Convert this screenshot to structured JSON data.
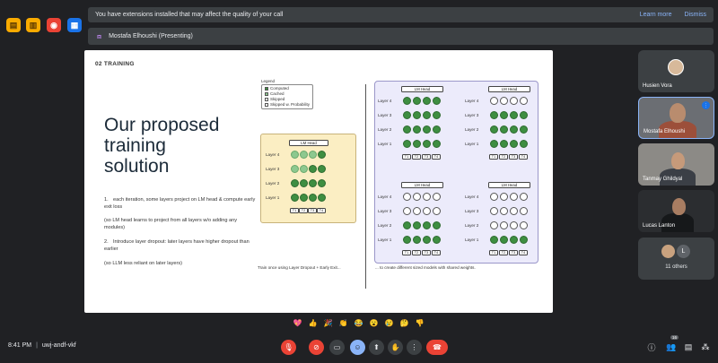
{
  "banner": {
    "warning_text": "You have extensions installed that may affect the quality of your call",
    "learn_more": "Learn more",
    "dismiss": "Dismiss",
    "presenter_text": "Mostafa Elhoushi (Presenting)"
  },
  "slide": {
    "section": "02  TRAINING",
    "title": "Our proposed\ntraining\nsolution",
    "bullet1_num": "1.",
    "bullet1": "each iteration, some layers project on LM head & compute early exit loss",
    "bullet1_note": "(so LM head learns to project from all layers w/o adding any modules)",
    "bullet2_num": "2.",
    "bullet2": "Introduce layer dropout: later layers have higher dropout than earlier",
    "bullet2_note": "(so LLM less reliant on later layers)",
    "legend_title": "Legend",
    "legend": [
      "Computed",
      "Cached",
      "Skipped",
      "Skipped w. Probability"
    ],
    "lm_head": "LM Head",
    "layers": [
      "Layer 4",
      "Layer 3",
      "Layer 2",
      "Layer 1"
    ],
    "tokens": [
      "T1",
      "T2",
      "T3",
      "T4"
    ],
    "caption_left": "Train once using Layer Dropout + Early Exit...",
    "caption_right": "... to create different sized models with shared weights."
  },
  "participants": [
    {
      "name": "Husien Vora"
    },
    {
      "name": "Mostafa Elhoushi"
    },
    {
      "name": "Tanmay Ghildyal"
    },
    {
      "name": "Lucas Lanton"
    }
  ],
  "others": {
    "label": "11 others",
    "initial": "L"
  },
  "reactions": [
    "💖",
    "👍",
    "🎉",
    "👏",
    "😂",
    "😮",
    "😢",
    "🤔",
    "👎"
  ],
  "meeting": {
    "time": "8:41 PM",
    "code": "uwj-andf-vkf",
    "participant_count": "16"
  },
  "colors": {
    "computed": "#3e8e41",
    "cached": "#8dc88f",
    "panel": "#ecebfb",
    "diagram": "#fbeec3",
    "accent": "#8ab4f8",
    "danger": "#ea4335"
  }
}
